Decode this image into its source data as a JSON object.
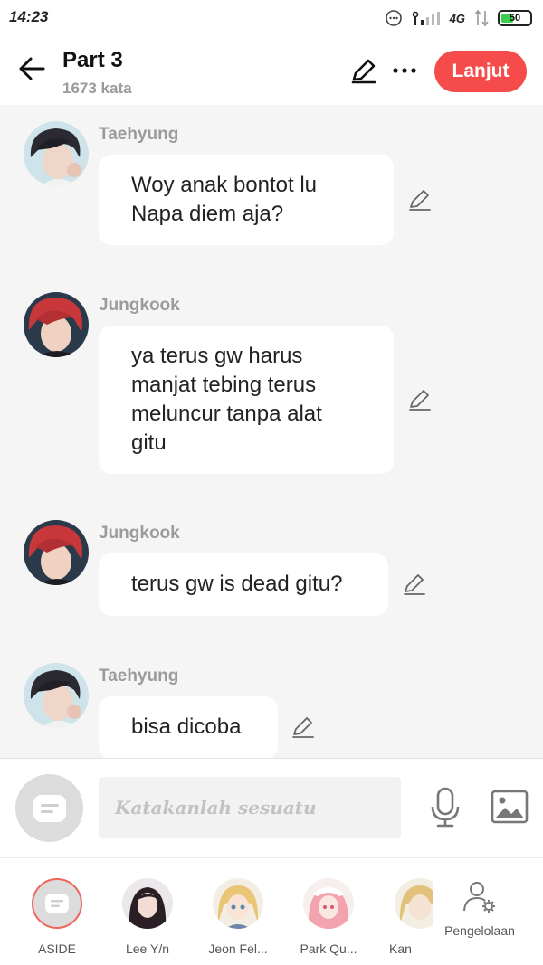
{
  "status_bar": {
    "time": "14:23",
    "network": "4G",
    "battery": "50",
    "battery_level_percent": 50
  },
  "header": {
    "title": "Part 3",
    "word_count": "1673 kata",
    "next_label": "Lanjut"
  },
  "messages": [
    {
      "sender": "Taehyung",
      "text": "Woy anak bontot lu\nNapa diem aja?"
    },
    {
      "sender": "Jungkook",
      "text": "ya terus gw harus\nmanjat tebing terus\nmeluncur tanpa alat\ngitu"
    },
    {
      "sender": "Jungkook",
      "text": "terus gw is dead gitu?"
    },
    {
      "sender": "Taehyung",
      "text": "bisa dicoba"
    }
  ],
  "input": {
    "placeholder": "Katakanlah sesuatu"
  },
  "characters": [
    {
      "label": "ASIDE"
    },
    {
      "label": "Lee Y/n"
    },
    {
      "label": "Jeon Fel..."
    },
    {
      "label": "Park Qu..."
    },
    {
      "label": "Kan"
    }
  ],
  "manage": {
    "label": "Pengelolaan"
  },
  "colors": {
    "accent": "#f54b4b",
    "bubble": "#ffffff",
    "background": "#f5f5f5",
    "muted_text": "#9b9b9b"
  }
}
